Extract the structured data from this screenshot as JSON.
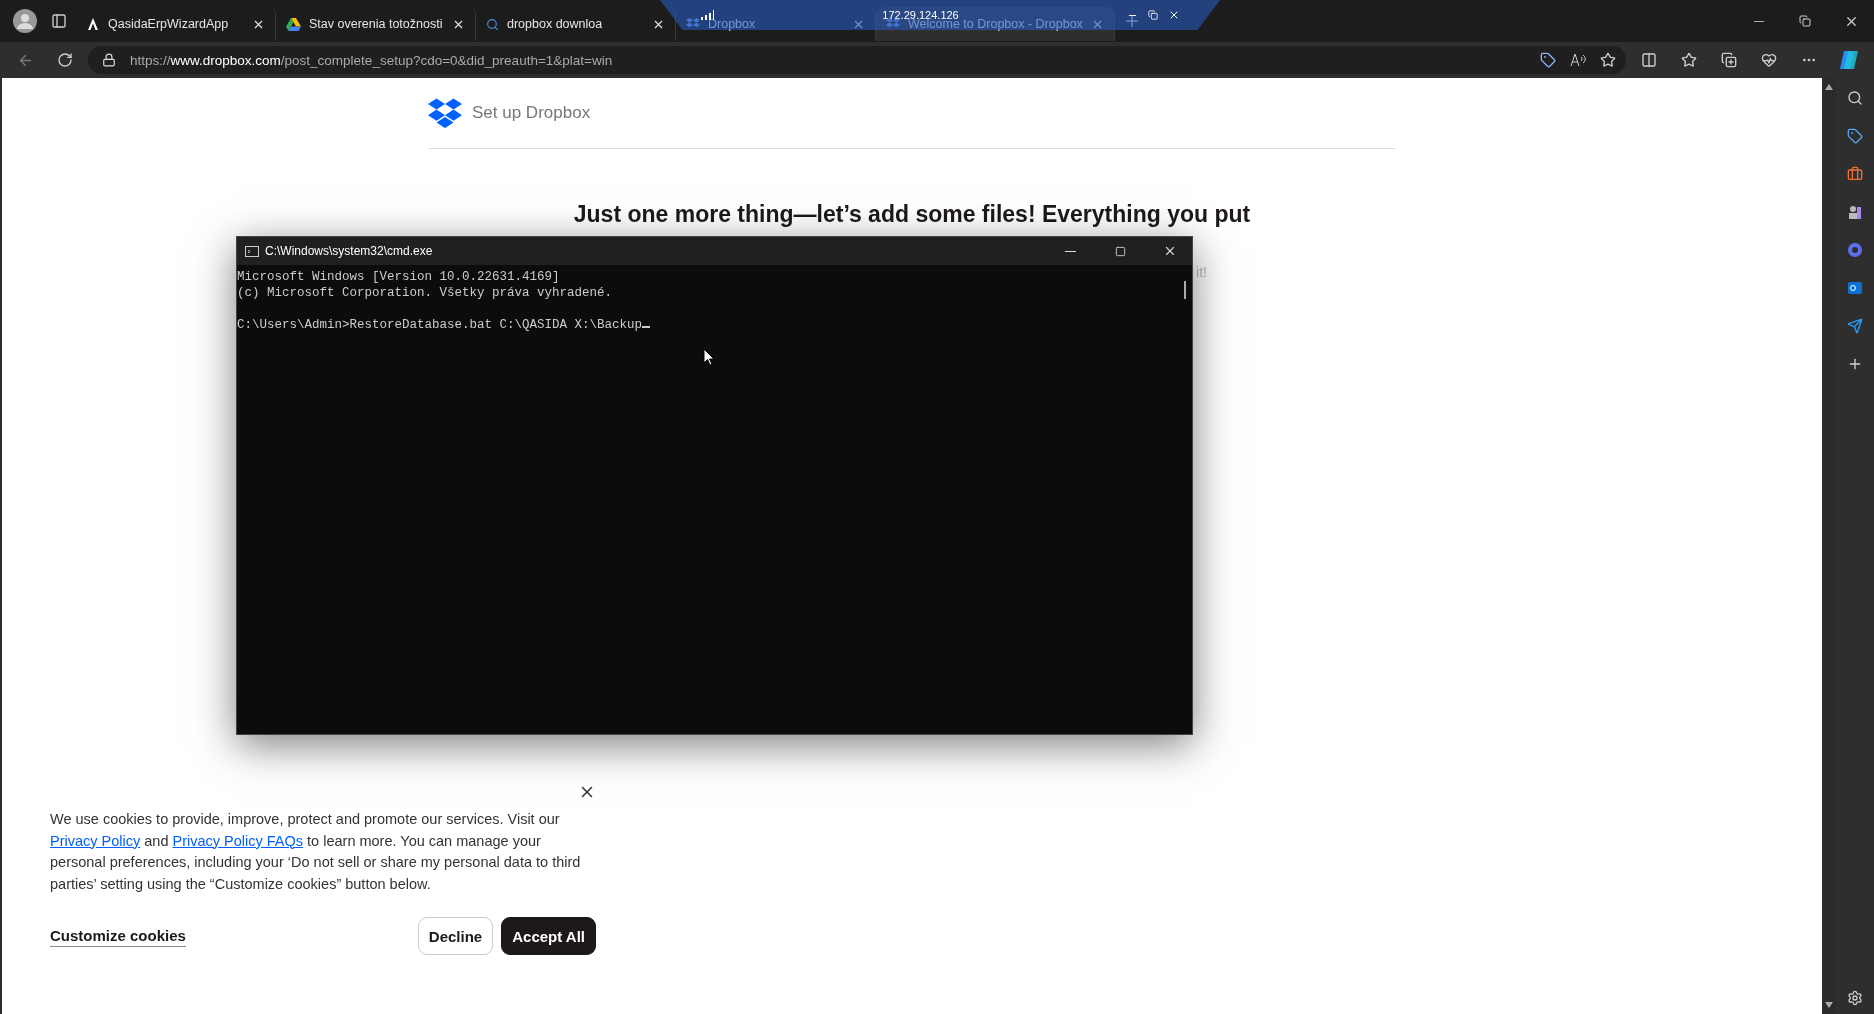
{
  "browser": {
    "tabs": [
      {
        "title": "QasidaErpWizardApp",
        "kind": "letter",
        "selected": false
      },
      {
        "title": "Stav overenia totožnosti",
        "kind": "drive",
        "selected": false
      },
      {
        "title": "dropbox downloa",
        "kind": "search",
        "selected": false
      },
      {
        "title": "Dropbox",
        "kind": "dropbox",
        "selected": false
      },
      {
        "title": "Welcome to Dropbox - Dropbox",
        "kind": "dropbox",
        "selected": true
      }
    ],
    "url_scheme": "https://",
    "url_host": "www.dropbox.com",
    "url_path": "/post_complete_setup?cdo=0&did_preauth=1&plat=win"
  },
  "remote_bar": {
    "address": "172.29.124.126"
  },
  "page": {
    "brand": "Set up Dropbox",
    "heading": "Just one more thing—let’s add some files! Everything you put",
    "subtitle_visible": "it!"
  },
  "console": {
    "title": "C:\\Windows\\system32\\cmd.exe",
    "lines": [
      "Microsoft Windows [Version 10.0.22631.4169]",
      "(c) Microsoft Corporation. Všetky práva vyhradené."
    ],
    "prompt": "C:\\Users\\Admin>RestoreDatabase.bat C:\\QASIDA X:\\Backup"
  },
  "cookies": {
    "text_before": "We use cookies to provide, improve, protect and promote our services. Visit our",
    "link1": "Privacy Policy",
    "and": "and",
    "link2": "Privacy Policy FAQs",
    "text_after": "to learn more. You can manage your personal preferences, including your ‘Do not sell or share my personal data to third parties’ setting using the “Customize cookies” button below.",
    "customize": "Customize cookies",
    "decline": "Decline",
    "accept": "Accept All"
  }
}
